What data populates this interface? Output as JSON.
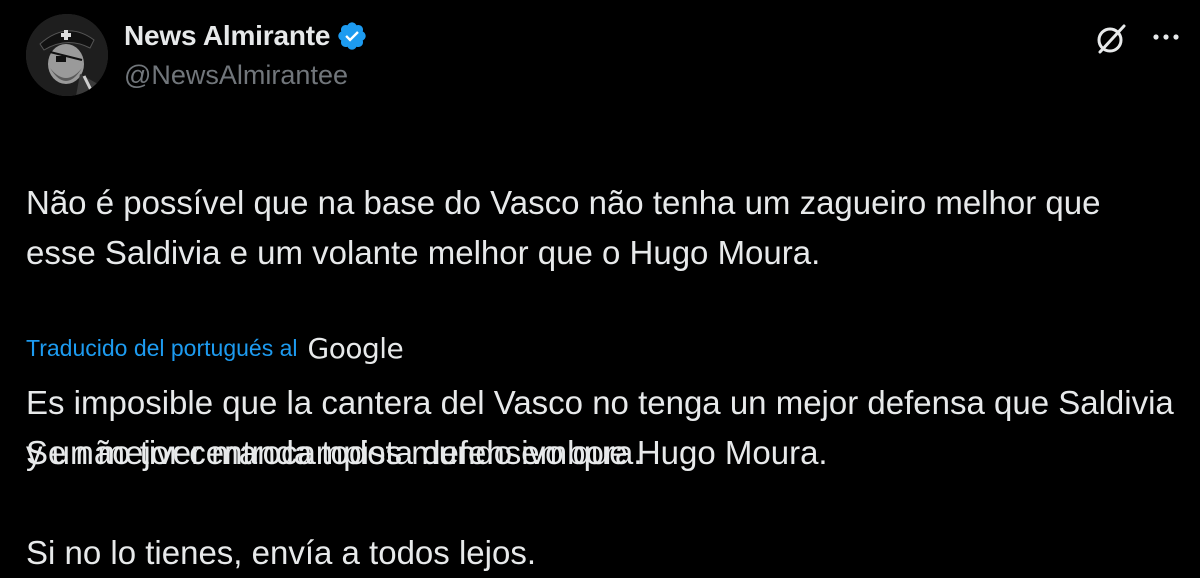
{
  "author": {
    "display_name": "News Almirante",
    "handle": "@NewsAlmirantee",
    "verified": true,
    "verified_color": "#1d9bf0"
  },
  "actions": {
    "grok_icon": "grok-icon",
    "more_icon": "more-icon"
  },
  "post": {
    "paragraph_1": "Não é possível que na base do Vasco não tenha um zagueiro melhor que esse Saldivia e um volante melhor que o Hugo Moura.",
    "paragraph_2": "Se não tiver manda todos mundo embora."
  },
  "translation": {
    "label": "Traducido del portugués al",
    "provider": "Google",
    "paragraph_1": "Es imposible que la cantera del Vasco no tenga un mejor defensa que Saldivia y un mejor centrocampista defensivo que Hugo Moura.",
    "paragraph_2": "Si no lo tienes, envía a todos lejos."
  },
  "colors": {
    "background": "#000000",
    "text": "#e7e9ea",
    "secondary_text": "#71767b",
    "link": "#1d9bf0"
  }
}
